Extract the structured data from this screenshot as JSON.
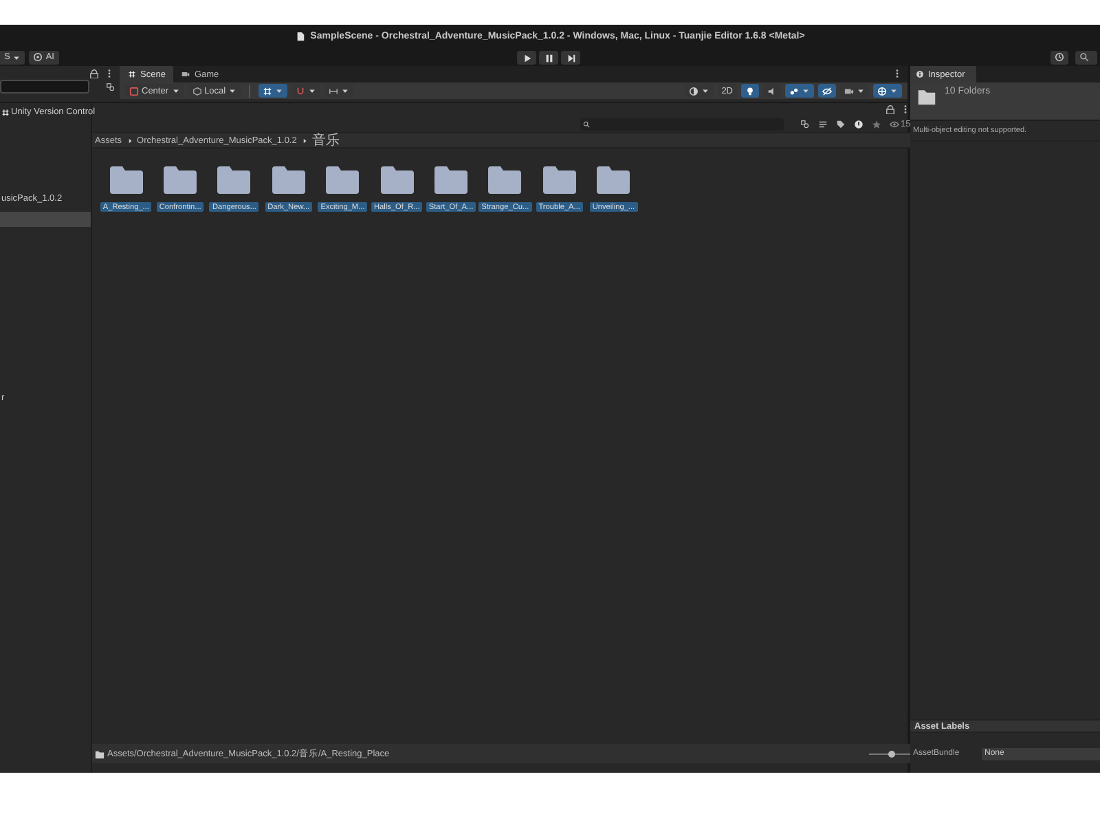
{
  "window": {
    "title": "SampleScene - Orchestral_Adventure_MusicPack_1.0.2 - Windows, Mac, Linux - Tuanjie Editor 1.6.8 <Metal>"
  },
  "toolbar": {
    "account_button": "S",
    "ai_button": "AI"
  },
  "scene_tabs": [
    {
      "label": "Scene",
      "selected": true
    },
    {
      "label": "Game",
      "selected": false
    }
  ],
  "scene_toolbar": {
    "left": [
      {
        "kind": "pivot",
        "label": "Center"
      },
      {
        "kind": "space",
        "label": "Local"
      },
      {
        "kind": "grid",
        "on": true
      },
      {
        "kind": "snap",
        "on": false
      },
      {
        "kind": "increment",
        "on": false
      }
    ],
    "right": [
      {
        "kind": "shading",
        "on": false
      },
      {
        "kind": "text",
        "label": "2D",
        "on": false
      },
      {
        "kind": "light",
        "on": true
      },
      {
        "kind": "audio",
        "on": false
      },
      {
        "kind": "effects",
        "on": true
      },
      {
        "kind": "visibility",
        "on": true
      },
      {
        "kind": "camera",
        "on": false
      },
      {
        "kind": "gizmos",
        "on": true
      }
    ]
  },
  "project": {
    "tree_items": [
      {
        "label": "Unity Version Control",
        "selected": false
      },
      {
        "label": "usicPack_1.0.2",
        "selected": false
      },
      {
        "selected": true
      },
      {
        "label": "r",
        "selected": false
      }
    ],
    "hidden_count": "15",
    "breadcrumb": [
      "Assets",
      "Orchestral_Adventure_MusicPack_1.0.2",
      "音乐"
    ],
    "folders": [
      {
        "label": "A_Resting_...",
        "selected": true
      },
      {
        "label": "Confrontin...",
        "selected": true
      },
      {
        "label": "Dangerous...",
        "selected": true
      },
      {
        "label": "Dark_New...",
        "selected": true
      },
      {
        "label": "Exciting_M...",
        "selected": true
      },
      {
        "label": "Halls_Of_R...",
        "selected": true
      },
      {
        "label": "Start_Of_A...",
        "selected": true
      },
      {
        "label": "Strange_Cu...",
        "selected": true
      },
      {
        "label": "Trouble_A...",
        "selected": true
      },
      {
        "label": "Unveiling_...",
        "selected": true
      }
    ],
    "status_path": "Assets/Orchestral_Adventure_MusicPack_1.0.2/音乐/A_Resting_Place",
    "zoom_slider": {
      "level": 0.55
    }
  },
  "inspector": {
    "tab": "Inspector",
    "heading": "10 Folders",
    "message": "Multi-object editing not supported.",
    "asset_labels": "Asset Labels",
    "asset_bundle_label": "AssetBundle",
    "asset_bundle_value": "None"
  }
}
